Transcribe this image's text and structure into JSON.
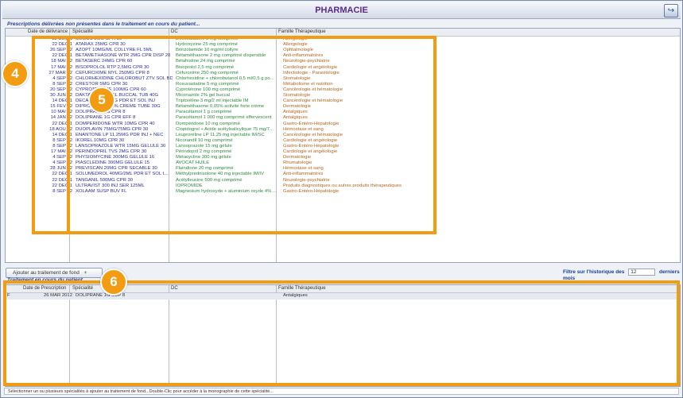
{
  "window": {
    "title": "PHARMACIE",
    "exit_icon": "exit-arrow-icon"
  },
  "prescriptions": {
    "section_title": "Prescriptions délivrées non présentes dans le traitement en cours du patient...",
    "columns": {
      "date": "Date de délivrance",
      "specialite": "Spécialité",
      "dc": "DC",
      "famille": "Famille Thérapeutique"
    },
    "rows": [
      {
        "date": "22 DEC 1",
        "spec": "SOMUS 5MG CPR 30",
        "dc": "Desloratadine 5 mg comprimé",
        "fam": "Allergologie"
      },
      {
        "date": "22 DEC 1",
        "spec": "ATARAX 25MG CPR 30",
        "dc": "Hydroxyzine 25 mg comprimé",
        "fam": "Allergologie"
      },
      {
        "date": "26 SEP 12",
        "spec": "AZOPT 10MG/ML COLLYRE FL 5ML",
        "dc": "Brinzolamide 10 mg/ml collyre",
        "fam": "Ophtalmologie"
      },
      {
        "date": "22 DEC 1",
        "spec": "BETAMETHASONE WTR 2MG CPR DISP 20",
        "dc": "Bétaméthasone 2 mg comprimé dispersible",
        "fam": "Anti-inflammatoires"
      },
      {
        "date": "18 MAI 12",
        "spec": "BETASERC 24MG CPR 60",
        "dc": "Bétahistine 24 mg comprimé",
        "fam": "Neurologie-psychiatrie"
      },
      {
        "date": "17 MAI 12",
        "spec": "BISOPROLOL RTP 2,5MG CPR 30",
        "dc": "Bisoprolol 2,5 mg comprimé",
        "fam": "Cardiologie et angéiologie"
      },
      {
        "date": "27 MAR 12",
        "spec": "CEFUROXIME MYL 250MG CPR 8",
        "dc": "Céfuroxime 250 mg comprimé",
        "fam": "Infectiologie - Parasitologie"
      },
      {
        "date": "4 SEP 12",
        "spec": "CHLORHEXIDINE CHLOROBUT ZTV SOL BDB ...",
        "dc": "Chlorhexidine + chlorobutanol 0,5 ml/0,5 g po...",
        "fam": "Stomatologie"
      },
      {
        "date": "8 SEP 12",
        "spec": "CRESTOR 5MG CPR 30",
        "dc": "Rosuvastatine 5 mg comprimé",
        "fam": "Métabolisme et nutrition"
      },
      {
        "date": "20 SEP 12",
        "spec": "CYPROTERONE 100MG CPR 60",
        "dc": "Cyprotérone 100 mg comprimé",
        "fam": "Cancérologie et hématologie"
      },
      {
        "date": "30 JUN 12",
        "spec": "DAKTARIN 2% GEL BUCCAL TUB 40G",
        "dc": "Miconazole 2% gel buccal",
        "fam": "Stomatologie"
      },
      {
        "date": "14 DEC 1",
        "spec": "DECAPEPTYL 3MG PDR ET SOL INJ",
        "dc": "Triptoréline 3 mg/2 ml injectable IM",
        "fam": "Cancérologie et hématologie"
      },
      {
        "date": "15 FEV 12",
        "spec": "DIPROSONE 0,05% CREME TUBE 30G",
        "dc": "Bétaméthasone 0,05% activité forte crème",
        "fam": "Dermatologie"
      },
      {
        "date": "10 MAI 12",
        "spec": "DOLIPRANE 1G CPR 8",
        "dc": "Paracétamol 1 g comprimé",
        "fam": "Antalgiques"
      },
      {
        "date": "14 JAN 12",
        "spec": "DOLIPRANE 1G CPR EFF 8",
        "dc": "Paracétamol 1 000 mg comprimé effervescent",
        "fam": "Antalgiques"
      },
      {
        "date": "22 DEC 1",
        "spec": "DOMPERIDONE WTR 10MG CPR 40",
        "dc": "Dompéridone 10 mg comprimé",
        "fam": "Gastro-Entéro-Hépatologie"
      },
      {
        "date": "18 AOU 12",
        "spec": "DUOPLAVIN 75MG/75MG CPR 30",
        "dc": "Clopidogrel + Acide acétylsalicylique 75 mg/7...",
        "fam": "Hémostase et sang"
      },
      {
        "date": "14 DEC 1",
        "spec": "ENANTONE LP 11,25MG PDR INJ + NEC",
        "dc": "Leuproréline LP 11,25 mg injectable IM/SC",
        "fam": "Cancérologie et hématologie"
      },
      {
        "date": "8 SEP 12",
        "spec": "IKOREL 10MG CPR 30",
        "dc": "Nicorandil 10 mg comprimé",
        "fam": "Cardiologie et angéiologie"
      },
      {
        "date": "8 SEP 12",
        "spec": "LANSOPRAZOLE WTR 15MG GELULE 30",
        "dc": "Lansoprazole 15 mg gélule",
        "fam": "Gastro-Entéro-Hépatologie"
      },
      {
        "date": "17 MAI 12",
        "spec": "PERINDOPRIL TVS 2MG CPR 30",
        "dc": "Périndopril 2 mg comprimé",
        "fam": "Cardiologie et angéiologie"
      },
      {
        "date": "4 SEP 12",
        "spec": "PHYSIOMYCINE 300MG GELULE 16",
        "dc": "Métacycline 300 mg gélule",
        "fam": "Dermatologie"
      },
      {
        "date": "4 SEP 12",
        "spec": "PIASCLEDINE 300MG GELULE 15",
        "dc": "AVOCAT HUILE",
        "fam": "Rhumatologie"
      },
      {
        "date": "28 JUN 12",
        "spec": "PREVISCAN 20MG CPR SECABLE 30",
        "dc": "Fluindione 20 mg comprimé",
        "fam": "Hémostase et sang"
      },
      {
        "date": "22 DEC 1",
        "spec": "SOLUMEDROL 40MG/2ML PDR ET SOL I...",
        "dc": "Méthylprednisolone 40 mg injectable IM/IV",
        "fam": "Anti-inflammatoires"
      },
      {
        "date": "22 DEC 1",
        "spec": "TANGANIL 500MG CPR 30",
        "dc": "Acétylleucine 500 mg comprimé",
        "fam": "Neurologie-psychiatrie"
      },
      {
        "date": "22 DEC 1",
        "spec": "ULTRAVIST 300 INJ SER 125ML",
        "dc": "IOPROMIDE",
        "fam": "Produits diagnostiques ou autres produits thérapeutiques"
      },
      {
        "date": "8 SEP 12",
        "spec": "XOLAAM SUSP BUV FL",
        "dc": "Magnesium hydroxyde + aluminium oxyde 4% ...",
        "fam": "Gastro-Entéro-Hépatologie"
      }
    ]
  },
  "actions": {
    "add_button": "Ajouter au traitement de fond",
    "add_icon": "plus-icon",
    "filter_label": "Filtre sur l'historique des",
    "filter_value": "12",
    "filter_unit": "derniers mois"
  },
  "treatment": {
    "section_title": "Traitement en cours du patient",
    "columns": {
      "date": "Date de Prescription",
      "specialite": "Spécialité",
      "dc": "DC",
      "famille": "Famille Thérapeutique"
    },
    "rows": [
      {
        "flag": "F",
        "date": "26 MAR 2012",
        "spec": "DOLIPRANE 1G SUP 8",
        "dc": "",
        "fam": "Antalgiques"
      }
    ]
  },
  "status": "Sélectionner un ou plusieurs spécialités à ajouter au traitement de fond...Double-Clic pour accéder à la monographie de cette spécialité...",
  "annotations": [
    {
      "label": "4",
      "color": "#f39c12"
    },
    {
      "label": "5",
      "color": "#f39c12"
    },
    {
      "label": "6",
      "color": "#f39c12"
    }
  ]
}
